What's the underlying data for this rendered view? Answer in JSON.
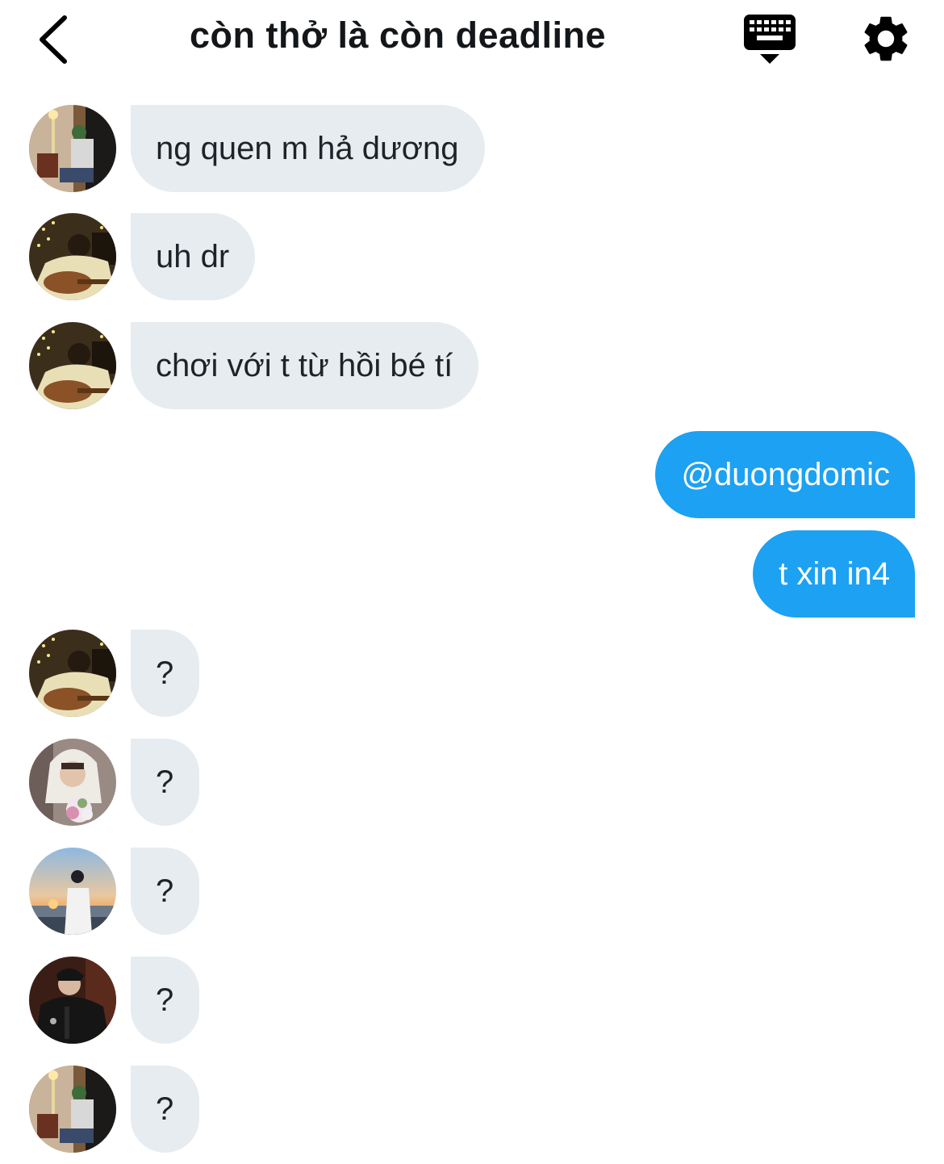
{
  "header": {
    "title": "còn thở là còn deadline",
    "back_icon": "chevron-left-icon",
    "keyboard_icon": "keyboard-icon",
    "settings_icon": "gear-icon"
  },
  "messages": [
    {
      "direction": "incoming",
      "avatar": "avatar-bedroom-man",
      "text": "ng quen m hả dương"
    },
    {
      "direction": "incoming",
      "avatar": "avatar-guitar",
      "text": "uh dr"
    },
    {
      "direction": "incoming",
      "avatar": "avatar-guitar",
      "text": "chơi với t từ hồi bé tí"
    },
    {
      "direction": "outgoing",
      "text": "@duongdomic"
    },
    {
      "direction": "outgoing",
      "text": "t xin in4"
    },
    {
      "direction": "incoming",
      "avatar": "avatar-guitar",
      "text": "?"
    },
    {
      "direction": "incoming",
      "avatar": "avatar-hoodie-flowers",
      "text": "?"
    },
    {
      "direction": "incoming",
      "avatar": "avatar-sunset-beach",
      "text": "?"
    },
    {
      "direction": "incoming",
      "avatar": "avatar-leather-jacket",
      "text": "?"
    },
    {
      "direction": "incoming",
      "avatar": "avatar-bedroom-man",
      "text": "?"
    }
  ],
  "colors": {
    "incoming_bubble": "#e6ecf0",
    "outgoing_bubble": "#1da1f2",
    "incoming_text": "#1f2328",
    "outgoing_text": "#ffffff"
  }
}
